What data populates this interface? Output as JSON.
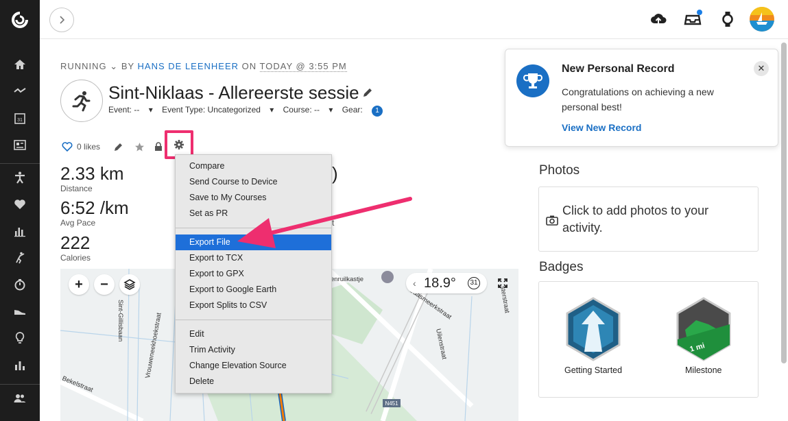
{
  "sidebar": {
    "items": [
      "home-icon",
      "activity-trend-icon",
      "calendar-icon",
      "news-feed-icon",
      "running-figure-icon",
      "heart-icon",
      "bar-chart-icon",
      "golf-icon",
      "stopwatch-icon",
      "shoe-icon",
      "lightbulb-icon",
      "reports-icon",
      "people-icon"
    ]
  },
  "topbar": {
    "icons": [
      "upload-icon",
      "inbox-icon",
      "watch-icon",
      "avatar"
    ],
    "notification_color": "#1a7ee6"
  },
  "header": {
    "activity_type": "RUNNING",
    "by_label": "BY",
    "author": "HANS DE LEENHEER",
    "on_label": "ON",
    "date": "TODAY @ 3:55 PM",
    "title": "Sint-Niklaas - Allereerste sessie",
    "event": "Event: --",
    "event_type": "Event Type: Uncategorized",
    "course": "Course: --",
    "gear_label": "Gear:",
    "gear_count": "1"
  },
  "actions": {
    "likes": "0 likes"
  },
  "stats": [
    {
      "value": "2.33 km",
      "label": "Distance"
    },
    {
      "value": "6:52 /km",
      "label": "Avg Pace"
    },
    {
      "value": "222",
      "label": "Calories"
    }
  ],
  "stats_partial": {
    "paren": ")",
    "t": "t"
  },
  "map": {
    "zoom_in": "+",
    "zoom_out": "−",
    "weather_temp": "18.9°",
    "weather_date": "31",
    "road_labels": [
      "Sint-Gillisbaan",
      "Vrouweneekhoekstraat",
      "Bekelstraat",
      "Uilenstraat",
      "N451",
      "enruilkastje",
      "Gaasmeerkstraat",
      "sterstraat"
    ]
  },
  "menu": {
    "group1": [
      "Compare",
      "Send Course to Device",
      "Save to My Courses",
      "Set as PR"
    ],
    "group2": [
      "Export File",
      "Export to TCX",
      "Export to GPX",
      "Export to Google Earth",
      "Export Splits to CSV"
    ],
    "group3": [
      "Edit",
      "Trim Activity",
      "Change Elevation Source",
      "Delete"
    ],
    "active": "Export File",
    "active_color": "#1e6fd9"
  },
  "annotation": {
    "highlight_color": "#ee2e6f"
  },
  "toast": {
    "title": "New Personal Record",
    "body": "Congratulations on achieving a new personal best!",
    "link": "View New Record",
    "close": "✕"
  },
  "photos": {
    "title": "Photos",
    "cta": "Click to add photos to your activity."
  },
  "badges": {
    "title": "Badges",
    "items": [
      {
        "label": "Getting Started"
      },
      {
        "label": "Milestone",
        "mark": "1 mi"
      }
    ]
  }
}
